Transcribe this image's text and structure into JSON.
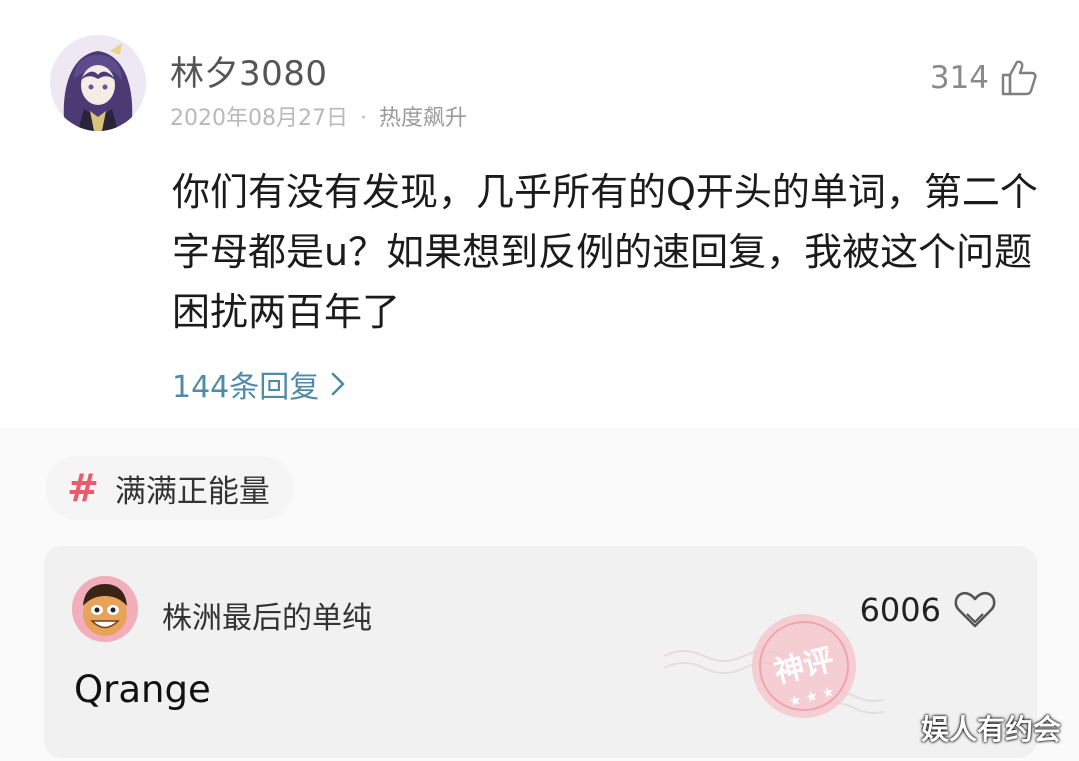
{
  "post": {
    "username": "林夕3080",
    "date": "2020年08月27日",
    "separator": "·",
    "hot_label": "热度飙升",
    "like_count": "314",
    "content": "你们有没有发现，几乎所有的Q开头的单词，第二个字母都是u？如果想到反例的速回复，我被这个问题困扰两百年了",
    "replies_label": "144条回复"
  },
  "tag": {
    "hash": "#",
    "label": "满满正能量"
  },
  "comment": {
    "username": "株洲最后的单纯",
    "like_count": "6006",
    "text": "Qrange",
    "badge_text": "神评"
  },
  "watermark": "娱人有约会",
  "icons": {
    "like": "thumbs-up-icon",
    "reply_arrow": "chevron-right-icon",
    "heart": "heart-icon",
    "badge": "stamp-icon"
  },
  "colors": {
    "reply_link": "#4f8aa8",
    "tag_hash": "#f0596c",
    "stamp": "#f0a4b1"
  }
}
